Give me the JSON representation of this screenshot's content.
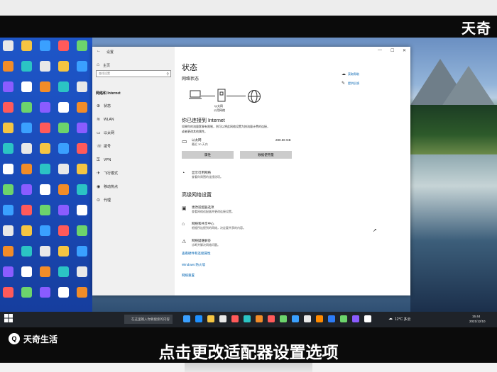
{
  "watermark": {
    "brand": "天奇",
    "logo_glyph": "Q",
    "logo_text": "天奇生活"
  },
  "caption": "点击更改适配器设置选项",
  "window": {
    "title": "设置",
    "back_glyph": "←",
    "controls": {
      "minimize": "—",
      "maximize": "☐",
      "close": "✕"
    },
    "sidebar": {
      "home_label": "主页",
      "search_placeholder": "查找设置",
      "section": "网络和 Internet",
      "items": [
        {
          "label": "状态",
          "icon": "globe-icon",
          "glyph": "⊕"
        },
        {
          "label": "WLAN",
          "icon": "wifi-icon",
          "glyph": "≋"
        },
        {
          "label": "以太网",
          "icon": "ethernet-icon",
          "glyph": "▭"
        },
        {
          "label": "拨号",
          "icon": "dialup-icon",
          "glyph": "☏"
        },
        {
          "label": "VPN",
          "icon": "vpn-icon",
          "glyph": "⚿"
        },
        {
          "label": "飞行模式",
          "icon": "airplane-icon",
          "glyph": "✈"
        },
        {
          "label": "移动热点",
          "icon": "hotspot-icon",
          "glyph": "◉"
        },
        {
          "label": "代理",
          "icon": "proxy-icon",
          "glyph": "⊙"
        }
      ]
    },
    "main": {
      "title": "状态",
      "network_status": "网络状态",
      "related": [
        "获取帮助",
        "提供反馈"
      ],
      "router_label": "以太网",
      "router_sub": "公用网络",
      "connected_title": "你已连接到 Internet",
      "desc_line1": "如果你的流量套餐有限制，则可以将此网络设置为按流量计费的连接，",
      "desc_line2": "或者更改其他属性。",
      "ethernet": {
        "name": "以太网",
        "sub": "最近 30 天内",
        "usage": "280.66 GB"
      },
      "buttons": {
        "properties": "属性",
        "data_usage": "数据使用量"
      },
      "show_available": {
        "title": "显示可用网络",
        "sub": "查看你周围的连接选项。"
      },
      "advanced_title": "高级网络设置",
      "rows": [
        {
          "title": "更改适配器选项",
          "sub": "查看网络适配器并更改连接设置。",
          "glyph": "▣"
        },
        {
          "title": "网络和共享中心",
          "sub": "根据所连接到的网络，决定要共享的内容。",
          "glyph": "⌂"
        },
        {
          "title": "网络疑难解答",
          "sub": "诊断并解决网络问题。",
          "glyph": "⚠"
        }
      ],
      "links": [
        "查看硬件和连接属性",
        "Windows 防火墙",
        "网络重置"
      ]
    }
  },
  "taskbar": {
    "search_placeholder": "在这里输入你要搜索的内容",
    "weather": "12°C 多云",
    "time": "15:44",
    "date": "2021/12/10"
  },
  "colors": {
    "accent": "#0063b1",
    "taskbar": "#1f2329",
    "bezel": "#0b0b0b"
  }
}
